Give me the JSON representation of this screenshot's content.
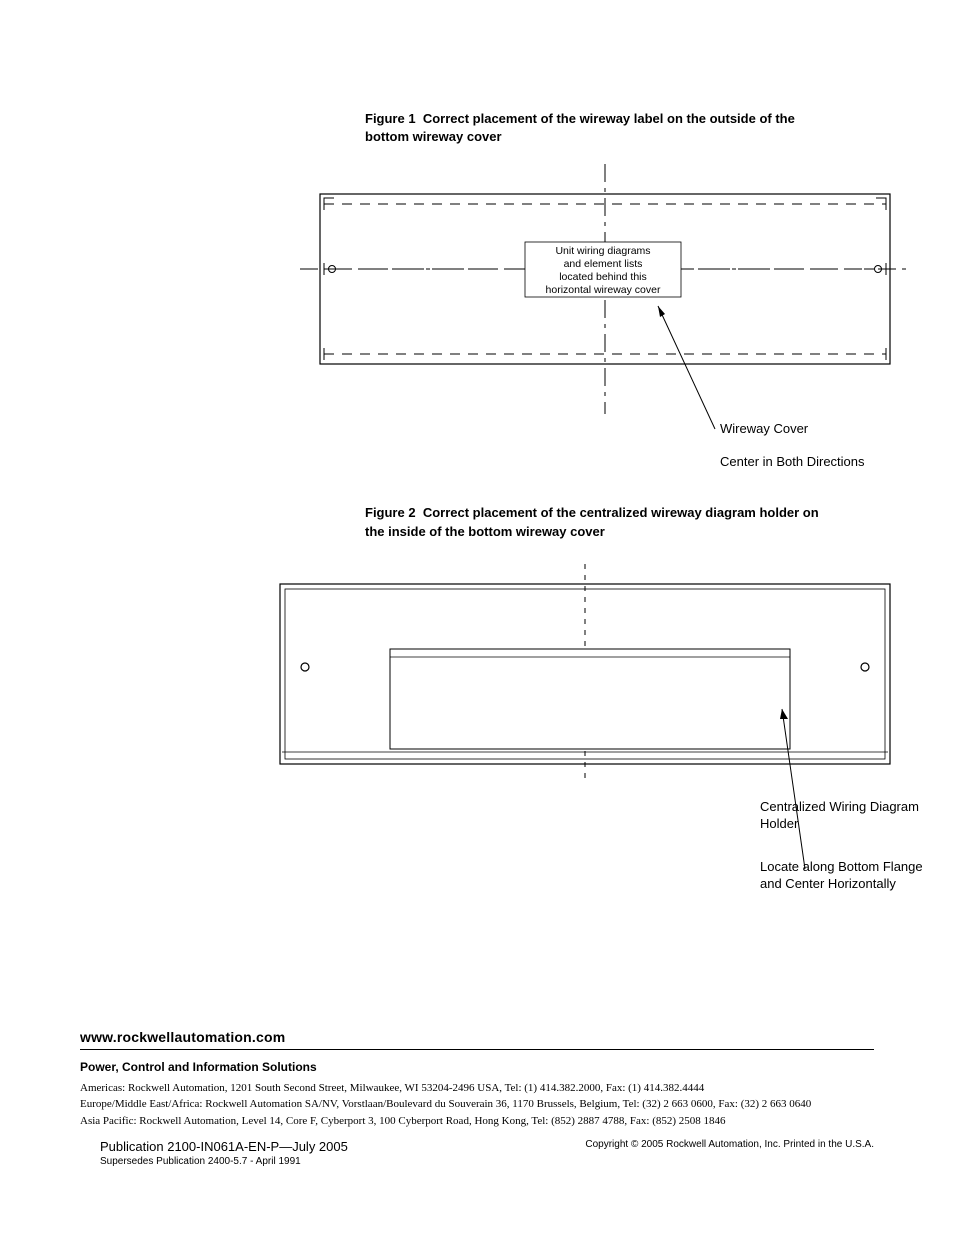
{
  "figure1": {
    "caption_prefix": "Figure 1",
    "caption": "Correct placement of the wireway label on the outside of the bottom wireway cover",
    "box_text_l1": "Unit wiring diagrams",
    "box_text_l2": "and element lists",
    "box_text_l3": "located behind this",
    "box_text_l4": "horizontal wireway cover",
    "annot_cover": "Wireway Cover",
    "annot_center": "Center in Both Directions"
  },
  "figure2": {
    "caption_prefix": "Figure 2",
    "caption": "Correct placement of the centralized wireway diagram holder on the inside of the bottom wireway cover",
    "annot_holder": "Centralized Wiring Diagram Holder",
    "annot_locate": "Locate along Bottom Flange and Center Horizontally"
  },
  "footer": {
    "url": "www.rockwellautomation.com",
    "slogan": "Power, Control and Information Solutions",
    "americas": "Americas: Rockwell Automation, 1201 South Second Street, Milwaukee, WI 53204-2496 USA, Tel: (1) 414.382.2000, Fax: (1) 414.382.4444",
    "emea": "Europe/Middle East/Africa: Rockwell Automation SA/NV, Vorstlaan/Boulevard du Souverain 36, 1170 Brussels, Belgium, Tel: (32) 2 663 0600, Fax: (32) 2 663 0640",
    "apac": "Asia Pacific: Rockwell Automation, Level 14, Core F, Cyberport 3, 100 Cyberport Road, Hong Kong, Tel: (852) 2887 4788, Fax: (852) 2508 1846",
    "publication": "Publication 2100-IN061A-EN-P—July 2005",
    "supersedes": "Supersedes Publication 2400-5.7 - April 1991",
    "copyright": "Copyright © 2005 Rockwell Automation, Inc. Printed in the U.S.A."
  },
  "chart_data": [
    {
      "type": "diagram",
      "title": "Figure 1 Correct placement of the wireway label on the outside of the bottom wireway cover",
      "elements": {
        "outline": "rectangular wireway cover, approx 2:1 aspect",
        "fold_lines": "two horizontal dashed fold lines with corner tabs at top line",
        "hinge_points": "two small circles on middle dashed line at left and right edges",
        "centerlines": "one vertical centerline, one horizontal centerline (dash-dot)",
        "label_box": "centered text box on cover face reading 'Unit wiring diagrams and element lists located behind this horizontal wireway cover'",
        "callouts": [
          "Wireway Cover (arrow to right side of cover)",
          "Center in Both Directions"
        ]
      }
    },
    {
      "type": "diagram",
      "title": "Figure 2 Correct placement of the centralized wireway diagram holder on the inside of the bottom wireway cover",
      "elements": {
        "outline": "rectangular double-line wireway cover, approx 3.3:1 aspect",
        "bottom_flange": "horizontal double line along bottom edge",
        "hinge_points": "two small circles at left and right, slightly above vertical center",
        "centerline": "vertical dashed centerline",
        "holder": "wide narrow rectangle centered horizontally, sitting on bottom flange, occupying ~70% of width",
        "callouts": [
          "Centralized Wiring Diagram Holder (arrow to holder right end)",
          "Locate along Bottom Flange and Center Horizontally"
        ]
      }
    }
  ]
}
